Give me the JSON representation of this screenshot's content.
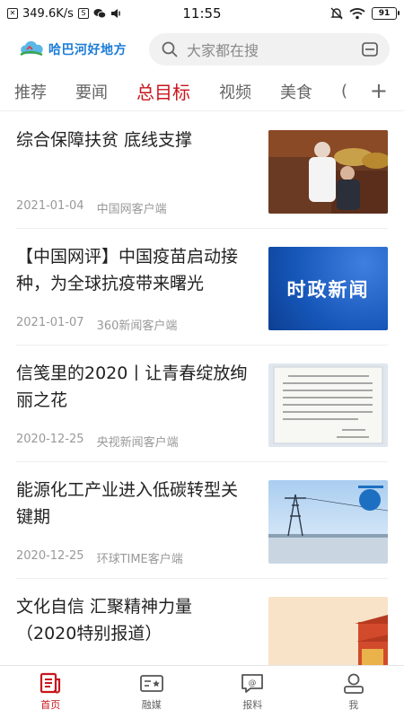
{
  "status_bar": {
    "speed": "349.6K/s",
    "time": "11:55",
    "battery": "91"
  },
  "header": {
    "logo_text": "哈巴河好地方",
    "search_placeholder": "大家都在搜"
  },
  "tabs": [
    {
      "label": "推荐",
      "active": false
    },
    {
      "label": "要闻",
      "active": false
    },
    {
      "label": "总目标",
      "active": true
    },
    {
      "label": "视频",
      "active": false
    },
    {
      "label": "美食",
      "active": false
    },
    {
      "label": "(",
      "active": false
    }
  ],
  "news": [
    {
      "title": "综合保障扶贫 底线支撑",
      "date": "2021-01-04",
      "source": "中国网客户端"
    },
    {
      "title": "【中国网评】中国疫苗启动接种，为全球抗疫带来曙光",
      "date": "2021-01-07",
      "source": "360新闻客户端",
      "thumb_text": "时政新闻"
    },
    {
      "title": "信笺里的2020丨让青春绽放绚丽之花",
      "date": "2020-12-25",
      "source": "央视新闻客户端"
    },
    {
      "title": "能源化工产业进入低碳转型关键期",
      "date": "2020-12-25",
      "source": "环球TIME客户端"
    },
    {
      "title": "文化自信 汇聚精神力量（2020特别报道）",
      "date": "",
      "source": ""
    }
  ],
  "bottom_nav": [
    {
      "label": "首页",
      "icon": "home-news-icon",
      "active": true
    },
    {
      "label": "融媒",
      "icon": "media-card-icon",
      "active": false
    },
    {
      "label": "报料",
      "icon": "report-chat-icon",
      "active": false
    },
    {
      "label": "我",
      "icon": "user-icon",
      "active": false
    }
  ],
  "colors": {
    "accent": "#c8161d",
    "logo_blue": "#1a7bd6",
    "search_bg": "#f1f1f1"
  }
}
